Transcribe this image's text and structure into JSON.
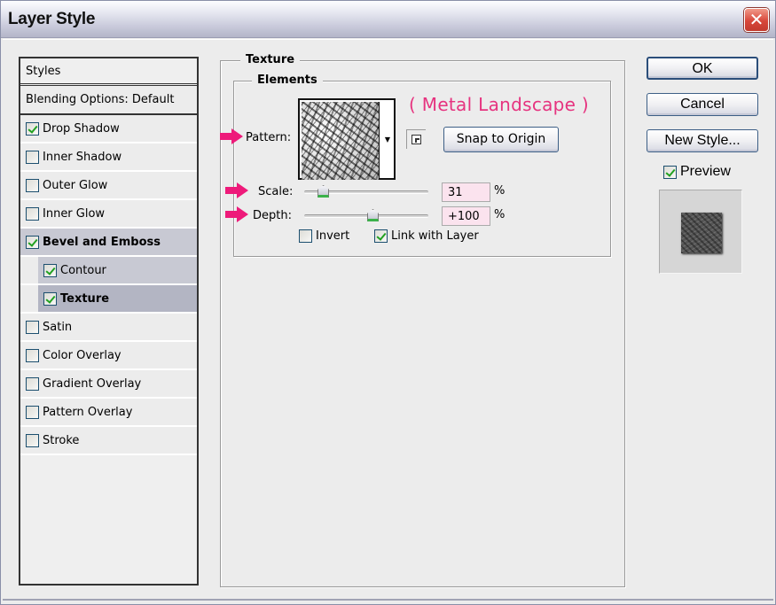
{
  "window": {
    "title": "Layer Style",
    "close_icon": "close-x-icon"
  },
  "styles_panel": {
    "header": "Styles",
    "blending_options": "Blending Options: Default",
    "items": [
      {
        "label": "Drop Shadow",
        "checked": true,
        "selected": false,
        "sub": false
      },
      {
        "label": "Inner Shadow",
        "checked": false,
        "selected": false,
        "sub": false
      },
      {
        "label": "Outer Glow",
        "checked": false,
        "selected": false,
        "sub": false
      },
      {
        "label": "Inner Glow",
        "checked": false,
        "selected": false,
        "sub": false
      },
      {
        "label": "Bevel and Emboss",
        "checked": true,
        "selected": true,
        "sub": false
      },
      {
        "label": "Contour",
        "checked": true,
        "selected": false,
        "sub": true
      },
      {
        "label": "Texture",
        "checked": true,
        "selected": true,
        "sub": true
      },
      {
        "label": "Satin",
        "checked": false,
        "selected": false,
        "sub": false
      },
      {
        "label": "Color Overlay",
        "checked": false,
        "selected": false,
        "sub": false
      },
      {
        "label": "Gradient Overlay",
        "checked": false,
        "selected": false,
        "sub": false
      },
      {
        "label": "Pattern Overlay",
        "checked": false,
        "selected": false,
        "sub": false
      },
      {
        "label": "Stroke",
        "checked": false,
        "selected": false,
        "sub": false
      }
    ]
  },
  "texture": {
    "group_title": "Texture",
    "elements_title": "Elements",
    "pattern_label": "Pattern:",
    "pattern_name_annotation": "( Metal Landscape )",
    "pattern_dropdown_icon": "triangle-down-icon",
    "new_preset_icon": "new-preset-icon",
    "snap_to_origin": "Snap to Origin",
    "scale": {
      "label": "Scale:",
      "value": "31",
      "unit": "%",
      "numeric": 31,
      "min": 1,
      "max": 200
    },
    "depth": {
      "label": "Depth:",
      "value": "+100",
      "unit": "%",
      "numeric": 100,
      "min": -1000,
      "max": 1000
    },
    "invert": {
      "label": "Invert",
      "checked": false
    },
    "link_with_layer": {
      "label": "Link with Layer",
      "checked": true
    },
    "annotation_color": "#e6337f"
  },
  "actions": {
    "ok": "OK",
    "cancel": "Cancel",
    "new_style": "New Style...",
    "preview": {
      "label": "Preview",
      "checked": true
    }
  }
}
